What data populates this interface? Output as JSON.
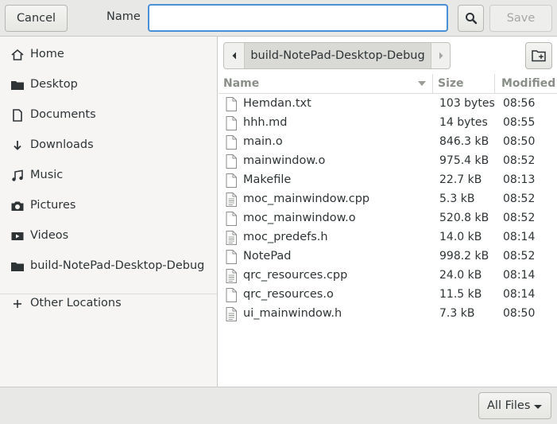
{
  "header": {
    "cancel_label": "Cancel",
    "name_label": "Name",
    "name_value": "",
    "save_label": "Save"
  },
  "sidebar": {
    "items": [
      {
        "label": "Home",
        "icon": "home-icon"
      },
      {
        "label": "Desktop",
        "icon": "folder-icon"
      },
      {
        "label": "Documents",
        "icon": "document-icon"
      },
      {
        "label": "Downloads",
        "icon": "download-icon"
      },
      {
        "label": "Music",
        "icon": "music-icon"
      },
      {
        "label": "Pictures",
        "icon": "camera-icon"
      },
      {
        "label": "Videos",
        "icon": "video-icon"
      },
      {
        "label": "build-NotePad-Desktop-Debug",
        "icon": "folder-icon"
      }
    ],
    "other_locations_label": "Other Locations"
  },
  "pathbar": {
    "current": "build-NotePad-Desktop-Debug"
  },
  "filelist": {
    "columns": {
      "name": "Name",
      "size": "Size",
      "modified": "Modified"
    },
    "rows": [
      {
        "name": "Hemdan.txt",
        "size": "103 bytes",
        "modified": "08:56",
        "icon": "text-file-icon"
      },
      {
        "name": "hhh.md",
        "size": "14 bytes",
        "modified": "08:55",
        "icon": "text-file-icon"
      },
      {
        "name": "main.o",
        "size": "846.3 kB",
        "modified": "08:50",
        "icon": "file-icon"
      },
      {
        "name": "mainwindow.o",
        "size": "975.4 kB",
        "modified": "08:52",
        "icon": "file-icon"
      },
      {
        "name": "Makefile",
        "size": "22.7 kB",
        "modified": "08:13",
        "icon": "file-icon"
      },
      {
        "name": "moc_mainwindow.cpp",
        "size": "5.3 kB",
        "modified": "08:52",
        "icon": "source-file-icon"
      },
      {
        "name": "moc_mainwindow.o",
        "size": "520.8 kB",
        "modified": "08:52",
        "icon": "file-icon"
      },
      {
        "name": "moc_predefs.h",
        "size": "14.0 kB",
        "modified": "08:14",
        "icon": "source-file-icon"
      },
      {
        "name": "NotePad",
        "size": "998.2 kB",
        "modified": "08:52",
        "icon": "file-icon"
      },
      {
        "name": "qrc_resources.cpp",
        "size": "24.0 kB",
        "modified": "08:14",
        "icon": "source-file-icon"
      },
      {
        "name": "qrc_resources.o",
        "size": "11.5 kB",
        "modified": "08:14",
        "icon": "file-icon"
      },
      {
        "name": "ui_mainwindow.h",
        "size": "7.3 kB",
        "modified": "08:50",
        "icon": "source-file-icon"
      }
    ]
  },
  "footer": {
    "filter_label": "All Files"
  },
  "colors": {
    "accent": "#4a90d9",
    "headerbar": "#e8e8e7",
    "sidebar": "#f6f5f4"
  }
}
